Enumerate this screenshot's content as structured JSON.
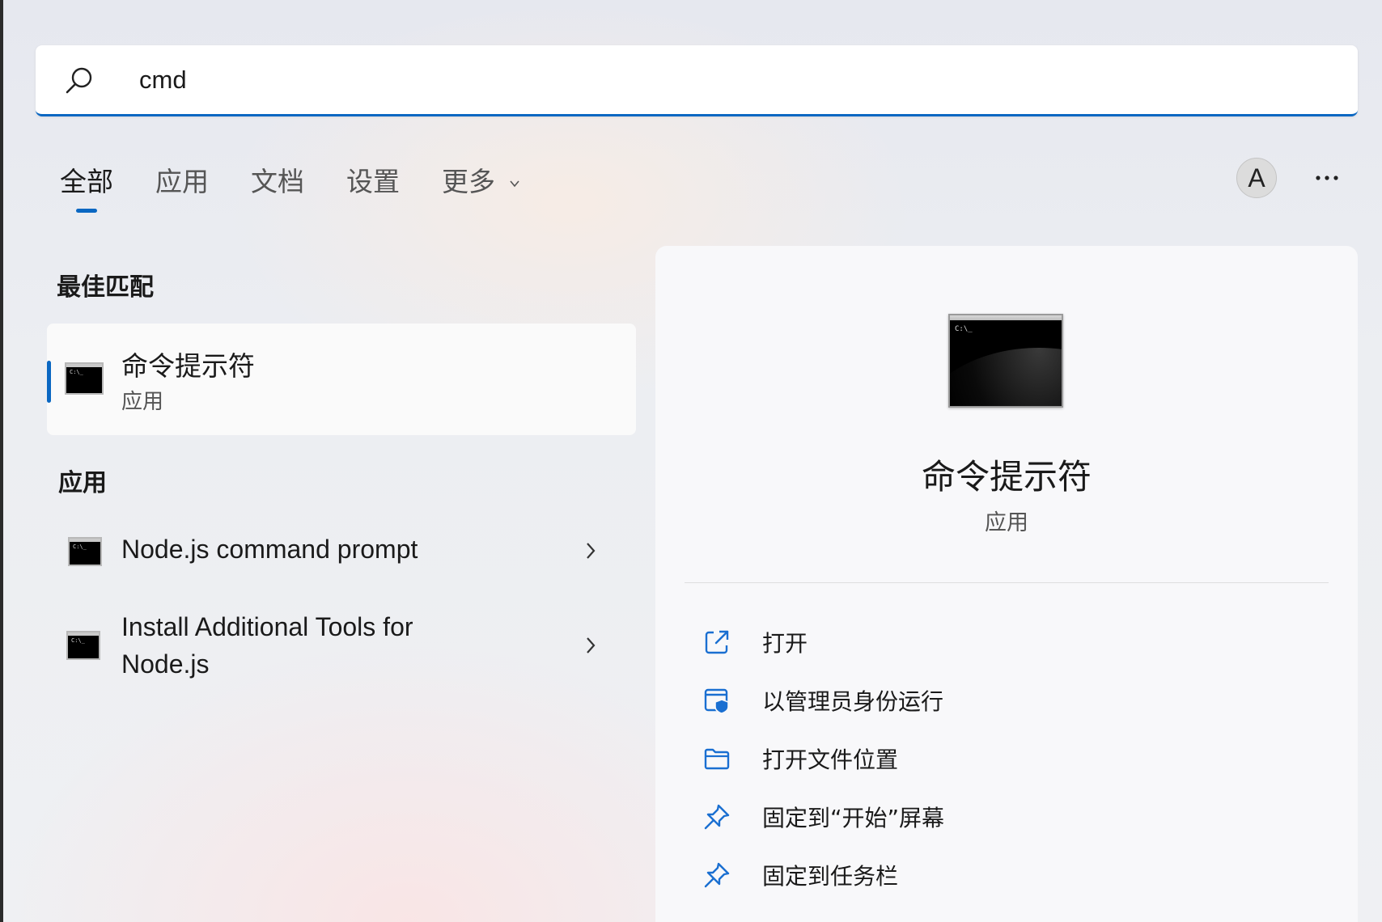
{
  "search": {
    "value": "cmd"
  },
  "tabs": [
    {
      "label": "全部"
    },
    {
      "label": "应用"
    },
    {
      "label": "文档"
    },
    {
      "label": "设置"
    },
    {
      "label": "更多"
    }
  ],
  "account": {
    "initial": "A"
  },
  "best_match": {
    "heading": "最佳匹配",
    "name": "命令提示符",
    "type": "应用"
  },
  "apps": {
    "heading": "应用",
    "items": [
      {
        "label": "Node.js command prompt"
      },
      {
        "label_line1": "Install Additional Tools for",
        "label_line2": "Node.js"
      }
    ]
  },
  "detail": {
    "name": "命令提示符",
    "type": "应用",
    "actions": [
      {
        "label": "打开",
        "icon": "open-external-icon"
      },
      {
        "label": "以管理员身份运行",
        "icon": "run-as-admin-icon"
      },
      {
        "label": "打开文件位置",
        "icon": "folder-icon"
      },
      {
        "label": "固定到“开始”屏幕",
        "icon": "pin-icon"
      },
      {
        "label": "固定到任务栏",
        "icon": "pin-icon"
      }
    ]
  },
  "colors": {
    "accent": "#0a67c2",
    "icon_blue": "#1a6fd1"
  }
}
